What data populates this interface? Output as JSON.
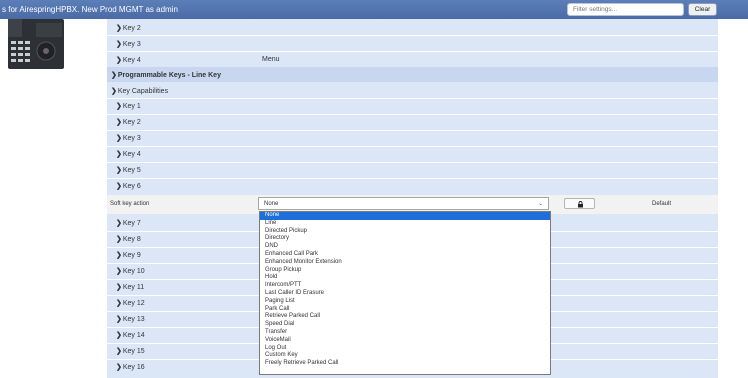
{
  "window": {
    "title": "s for AirespringHPBX. New Prod MGMT as admin"
  },
  "filter": {
    "placeholder": "Filter settings..."
  },
  "clear_label": "Clear",
  "keys_top": [
    {
      "label": "Key 2",
      "value": ""
    },
    {
      "label": "Key 3",
      "value": ""
    },
    {
      "label": "Key 4",
      "value": "Menu"
    }
  ],
  "section": {
    "title": "Programmable Keys - Line Key"
  },
  "key_capabilities_label": "Key Capabilities",
  "keys_mid": [
    {
      "label": "Key 1"
    },
    {
      "label": "Key 2"
    },
    {
      "label": "Key 3"
    },
    {
      "label": "Key 4"
    },
    {
      "label": "Key 5"
    }
  ],
  "key6_label": "Key 6",
  "soft_key": {
    "label": "Soft key action",
    "selected": "None",
    "default_label": "Default"
  },
  "dropdown_options": [
    "None",
    "Line",
    "Directed Pickup",
    "Directory",
    "DND",
    "Enhanced Call Park",
    "Enhanced Monitor Extension",
    "Group Pickup",
    "Hold",
    "Intercom/PTT",
    "Last Caller ID Erasure",
    "Paging List",
    "Park Call",
    "Retrieve Parked Call",
    "Speed Dial",
    "Transfer",
    "VoiceMail",
    "Log Out",
    "Custom Key",
    "Freely Retrieve Parked Call"
  ],
  "keys_bottom": [
    {
      "label": "Key 7"
    },
    {
      "label": "Key 8"
    },
    {
      "label": "Key 9"
    },
    {
      "label": "Key 10"
    },
    {
      "label": "Key 11"
    },
    {
      "label": "Key 12"
    },
    {
      "label": "Key 13"
    },
    {
      "label": "Key 14"
    },
    {
      "label": "Key 15"
    },
    {
      "label": "Key 16"
    }
  ],
  "icons": {
    "expand": "chevron-right-icon",
    "collapse": "chevron-down-icon",
    "lock": "lock-icon",
    "select_caret": "chevron-down-icon"
  },
  "colors": {
    "titlebar": "#4a6aa6",
    "panel": "#dbe6f7",
    "section_header": "#c8d6f0",
    "selected_option": "#1e6fd9"
  }
}
